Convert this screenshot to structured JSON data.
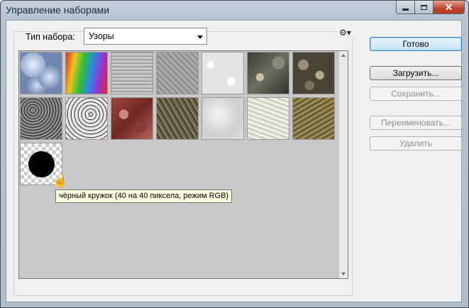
{
  "window": {
    "title": "Управление наборами",
    "controls": [
      "minimize",
      "maximize",
      "close"
    ],
    "close_glyph": "✕"
  },
  "preset": {
    "type_label": "Тип набора:",
    "selected": "Узоры"
  },
  "menu_icon": "⚙",
  "menu_glyph": "⚙▾",
  "patterns": [
    {
      "texture": "blue-bubbles-pattern"
    },
    {
      "texture": "rainbow-pattern"
    },
    {
      "texture": "gray-fabric-pattern"
    },
    {
      "texture": "gray-noise-pattern"
    },
    {
      "texture": "white-paper-pattern"
    },
    {
      "texture": "dark-rock-pattern"
    },
    {
      "texture": "pebbles-pattern"
    },
    {
      "texture": "gravel-pattern"
    },
    {
      "texture": "granite-pattern"
    },
    {
      "texture": "red-stone-pattern"
    },
    {
      "texture": "moss-pattern"
    },
    {
      "texture": "light-marble-pattern"
    },
    {
      "texture": "light-texture-pattern"
    },
    {
      "texture": "olive-grain-pattern"
    },
    {
      "texture": "black-circle-pattern"
    }
  ],
  "tooltip": "чёрный кружок (40 на 40 пиксела, режим RGB)",
  "buttons": {
    "done": "Готово",
    "load": "Загрузить...",
    "save": "Сохранить...",
    "rename": "Переименовать...",
    "delete": "Удалить"
  },
  "colors": {
    "accent": "#3c7fb1",
    "close": "#c0442c",
    "tooltip_bg": "#ffffe1"
  }
}
